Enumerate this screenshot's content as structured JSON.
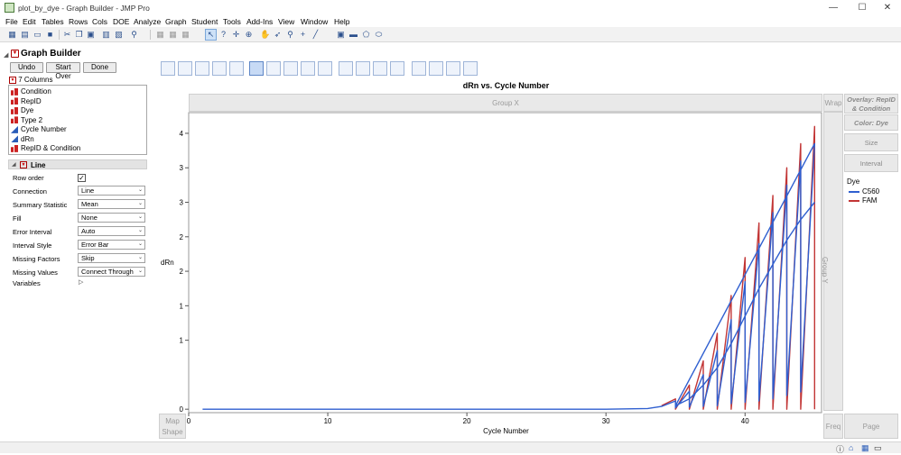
{
  "window": {
    "title": "plot_by_dye - Graph Builder - JMP Pro",
    "controls": [
      "—",
      "☐",
      "✕"
    ]
  },
  "menu": [
    "File",
    "Edit",
    "Tables",
    "Rows",
    "Cols",
    "DOE",
    "Analyze",
    "Graph",
    "Student",
    "Tools",
    "Add-Ins",
    "View",
    "Window",
    "Help"
  ],
  "toolbar_icons": [
    "new-table-icon",
    "new-script-icon",
    "open-icon",
    "save-icon",
    "cut-icon",
    "copy-icon",
    "paste-icon",
    "journal-icon",
    "layout-icon",
    "search-icon",
    "rows-icon",
    "cols-icon",
    "arrow-icon",
    "help-icon",
    "crosshair-icon",
    "scroller-icon",
    "hand-icon",
    "lasso-icon",
    "magnifier-icon",
    "plus-icon",
    "line-icon",
    "annotate-icon",
    "simple-shape-icon",
    "polygon-icon",
    "ellipse-icon"
  ],
  "panel": {
    "title": "Graph Builder",
    "buttons": {
      "undo": "Undo",
      "start_over": "Start Over",
      "done": "Done"
    },
    "columns_header": "7 Columns",
    "columns": [
      {
        "name": "Condition",
        "type": "nominal"
      },
      {
        "name": "RepID",
        "type": "nominal"
      },
      {
        "name": "Dye",
        "type": "nominal"
      },
      {
        "name": "Type 2",
        "type": "nominal"
      },
      {
        "name": "Cycle Number",
        "type": "continuous"
      },
      {
        "name": "dRn",
        "type": "continuous"
      },
      {
        "name": "RepID & Condition",
        "type": "nominal"
      }
    ],
    "element_title": "Line",
    "options": [
      {
        "label": "Row order",
        "kind": "checkbox",
        "value": "✓"
      },
      {
        "label": "Connection",
        "kind": "dropdown",
        "value": "Line"
      },
      {
        "label": "Summary Statistic",
        "kind": "dropdown",
        "value": "Mean"
      },
      {
        "label": "Fill",
        "kind": "dropdown",
        "value": "None"
      },
      {
        "label": "Error Interval",
        "kind": "dropdown",
        "value": "Auto"
      },
      {
        "label": "Interval Style",
        "kind": "dropdown",
        "value": "Error Bar"
      },
      {
        "label": "Missing Factors",
        "kind": "dropdown",
        "value": "Skip"
      },
      {
        "label": "Missing Values",
        "kind": "dropdown",
        "value": "Connect Through"
      },
      {
        "label": "Variables",
        "kind": "expander",
        "value": ""
      }
    ]
  },
  "zones": {
    "group_x": "Group X",
    "group_y": "Group Y",
    "wrap": "Wrap",
    "overlay": "Overlay: RepID & Condition",
    "color": "Color: Dye",
    "size": "Size",
    "interval": "Interval",
    "map_shape": "Map Shape",
    "freq": "Freq",
    "page": "Page"
  },
  "colors": {
    "C560": "#2f5fd0",
    "FAM": "#c23535",
    "accent": "#5d86c6"
  },
  "chart_data": {
    "type": "line",
    "title": "dRn vs. Cycle Number",
    "xlabel": "Cycle Number",
    "ylabel": "dRn",
    "xlim": [
      0,
      45.5
    ],
    "ylim": [
      -0.05,
      4.3
    ],
    "xticks": [
      0,
      10,
      20,
      30,
      40
    ],
    "yticks": [
      0,
      1,
      2,
      3,
      4
    ],
    "ytick_labels": [
      "0",
      "1",
      "1",
      "2",
      "2",
      "3",
      "3",
      "4"
    ],
    "ytick_values": [
      0,
      1,
      1.5,
      2,
      2.5,
      3,
      3.5,
      4
    ],
    "legend": {
      "title": "Dye",
      "position": "right"
    },
    "series": [
      {
        "name": "C560",
        "x": [
          1,
          5,
          10,
          15,
          20,
          25,
          30,
          33,
          34,
          35,
          35,
          36,
          36,
          37,
          37,
          38,
          38,
          39,
          39,
          40,
          40,
          41,
          41,
          42,
          42,
          43,
          43,
          44,
          44,
          45,
          35,
          36,
          37,
          38,
          39,
          40,
          41,
          42,
          43,
          44,
          45
        ],
        "y": [
          0.0,
          0.0,
          0.0,
          0.0,
          0.0,
          0.0,
          0.0,
          0.01,
          0.04,
          0.12,
          0.02,
          0.26,
          0.03,
          0.5,
          0.04,
          0.85,
          0.05,
          1.3,
          0.08,
          1.85,
          0.1,
          2.4,
          0.12,
          2.85,
          0.15,
          3.25,
          0.2,
          3.6,
          0.25,
          3.85,
          0.05,
          0.15,
          0.35,
          0.6,
          0.95,
          1.35,
          1.75,
          2.1,
          2.45,
          2.75,
          3.0
        ]
      },
      {
        "name": "FAM",
        "x": [
          34,
          35,
          35,
          36,
          36,
          37,
          37,
          38,
          38,
          39,
          39,
          40,
          40,
          41,
          41,
          42,
          42,
          43,
          43,
          44,
          44,
          45,
          45
        ],
        "y": [
          0.05,
          0.15,
          0.0,
          0.35,
          0.0,
          0.7,
          0.0,
          1.1,
          0.0,
          1.65,
          0.0,
          2.2,
          0.0,
          2.7,
          0.0,
          3.1,
          0.0,
          3.5,
          0.0,
          3.85,
          0.0,
          4.1,
          0.0
        ]
      }
    ]
  }
}
